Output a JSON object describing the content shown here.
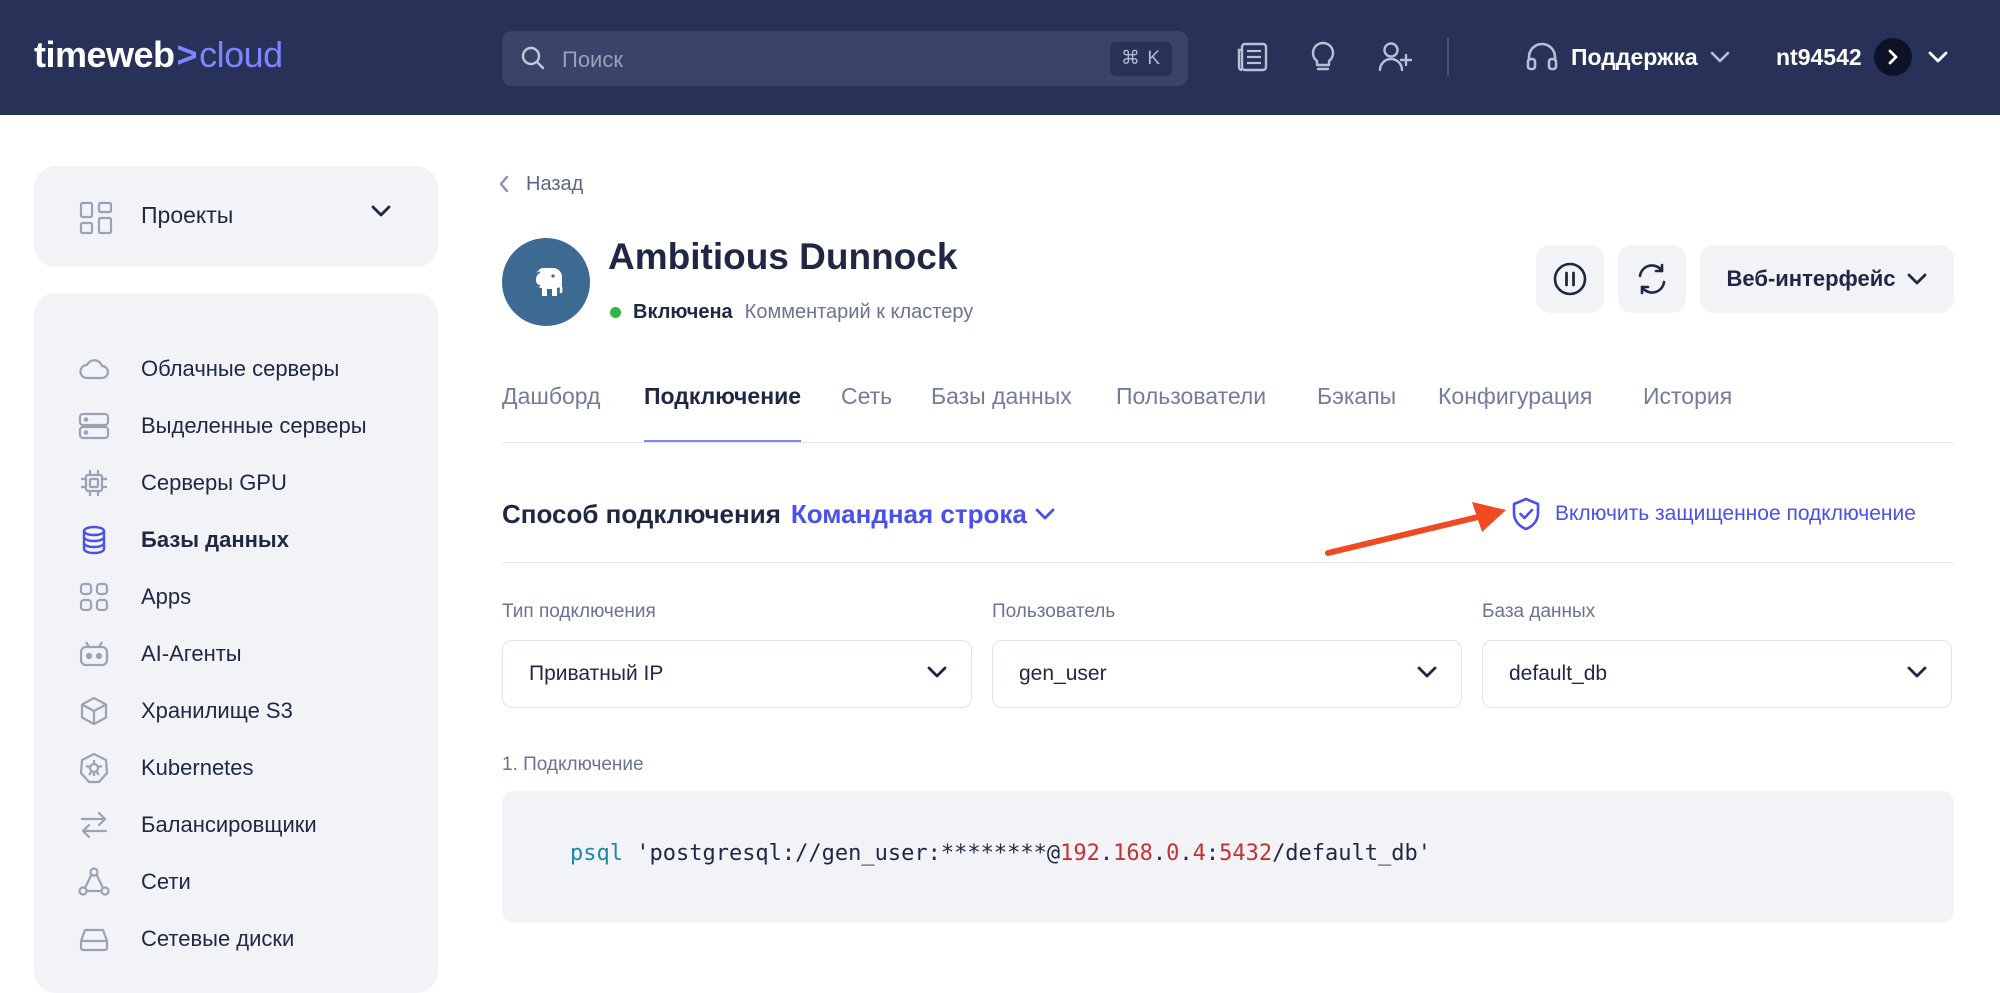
{
  "topbar": {
    "logo": {
      "part1": "timeweb",
      "separator": ">",
      "part2": "cloud"
    },
    "search": {
      "placeholder": "Поиск",
      "shortcut": "⌘ K"
    },
    "icons": [
      "news-icon",
      "lightbulb-icon",
      "add-user-icon"
    ],
    "support_label": "Поддержка",
    "account_name": "nt94542"
  },
  "sidebar": {
    "projects_label": "Проекты",
    "items": [
      {
        "label": "Облачные серверы",
        "icon": "cloud-icon",
        "active": false
      },
      {
        "label": "Выделенные серверы",
        "icon": "server-icon",
        "active": false
      },
      {
        "label": "Серверы GPU",
        "icon": "gpu-chip-icon",
        "active": false
      },
      {
        "label": "Базы данных",
        "icon": "database-icon",
        "active": true
      },
      {
        "label": "Apps",
        "icon": "apps-icon",
        "active": false
      },
      {
        "label": "AI-Агенты",
        "icon": "robot-icon",
        "active": false
      },
      {
        "label": "Хранилище S3",
        "icon": "cube-icon",
        "active": false
      },
      {
        "label": "Kubernetes",
        "icon": "kubernetes-icon",
        "active": false
      },
      {
        "label": "Балансировщики",
        "icon": "balancer-arrows-icon",
        "active": false
      },
      {
        "label": "Сети",
        "icon": "network-icon",
        "active": false
      },
      {
        "label": "Сетевые диски",
        "icon": "disk-icon",
        "active": false
      }
    ]
  },
  "main": {
    "back_label": "Назад",
    "cluster": {
      "name": "Ambitious Dunnock",
      "status": "Включена",
      "comment_link": "Комментарий к кластеру"
    },
    "web_interface_label": "Веб-интерфейс",
    "tabs": [
      {
        "label": "Дашборд",
        "active": false
      },
      {
        "label": "Подключение",
        "active": true
      },
      {
        "label": "Сеть",
        "active": false
      },
      {
        "label": "Базы данных",
        "active": false
      },
      {
        "label": "Пользователи",
        "active": false
      },
      {
        "label": "Бэкапы",
        "active": false
      },
      {
        "label": "Конфигурация",
        "active": false
      },
      {
        "label": "История",
        "active": false
      }
    ],
    "connection": {
      "title": "Способ подключения",
      "method": "Командная строка",
      "secure_link": "Включить защищенное подключение"
    },
    "fields": [
      {
        "label": "Тип подключения",
        "value": "Приватный IP"
      },
      {
        "label": "Пользователь",
        "value": "gen_user"
      },
      {
        "label": "База данных",
        "value": "default_db"
      }
    ],
    "step_label": "1. Подключение",
    "code": {
      "command": "psql",
      "prefix": " 'postgresql://gen_user:********@",
      "ip_parts": [
        "192",
        "168",
        "0",
        "4"
      ],
      "port": "5432",
      "suffix": "/default_db'"
    }
  },
  "colors": {
    "topbar_bg": "#283259",
    "accent": "#4a51ea",
    "status_green": "#32b44a",
    "arrow_red": "#f04a23"
  }
}
